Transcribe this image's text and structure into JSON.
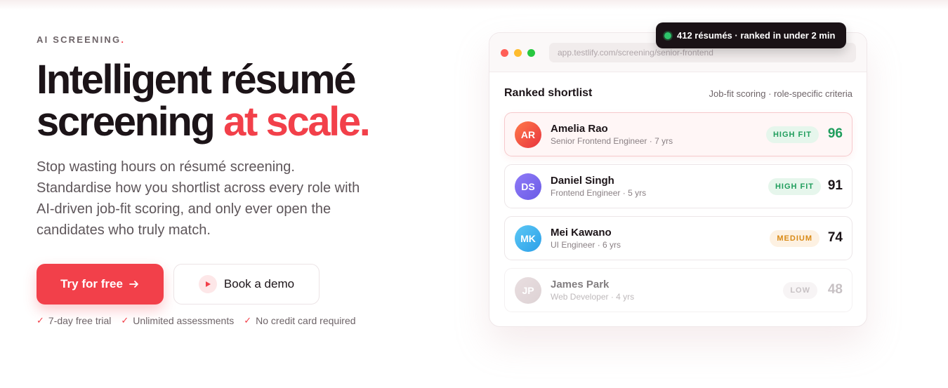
{
  "hero": {
    "eyebrow": "AI SCREENING",
    "eyebrow_dot": ".",
    "headline_line1": "Intelligent résumé",
    "headline_line2_start": "screening ",
    "headline_accent": "at scale.",
    "subtext": "Stop wasting hours on résumé screening. Standardise how you shortlist across every role with AI-driven job-fit scoring, and only ever open the candidates who truly match.",
    "primary_label": "Try for free",
    "secondary_label": "Book a demo",
    "perks": [
      "7-day free trial",
      "Unlimited assessments",
      "No credit card required"
    ]
  },
  "toast": {
    "text": "412 résumés · ranked in under 2 min"
  },
  "window": {
    "url": "app.testlify.com/screening/senior-frontend"
  },
  "card": {
    "title": "Ranked shortlist",
    "meta": "Job-fit scoring · role-specific criteria"
  },
  "candidates": [
    {
      "initials": "AR",
      "name": "Amelia Rao",
      "role": "Senior Frontend Engineer · 7 yrs",
      "badge": "HIGH FIT",
      "score": "96"
    },
    {
      "initials": "DS",
      "name": "Daniel Singh",
      "role": "Frontend Engineer · 5 yrs",
      "badge": "HIGH FIT",
      "score": "91"
    },
    {
      "initials": "MK",
      "name": "Mei Kawano",
      "role": "UI Engineer · 6 yrs",
      "badge": "MEDIUM",
      "score": "74"
    },
    {
      "initials": "JP",
      "name": "James Park",
      "role": "Web Developer · 4 yrs",
      "badge": "LOW",
      "score": "48"
    }
  ],
  "colors": {
    "brand": "#f2404a",
    "dark": "#1c1418",
    "high_fit": "#1f9d5c",
    "medium": "#d98a16",
    "low": "#9a9094"
  },
  "icons": {
    "primary_arrow": "arrow-right-icon",
    "demo_play": "play-icon",
    "perk_check": "check-icon",
    "toast_status": "status-dot-icon"
  }
}
